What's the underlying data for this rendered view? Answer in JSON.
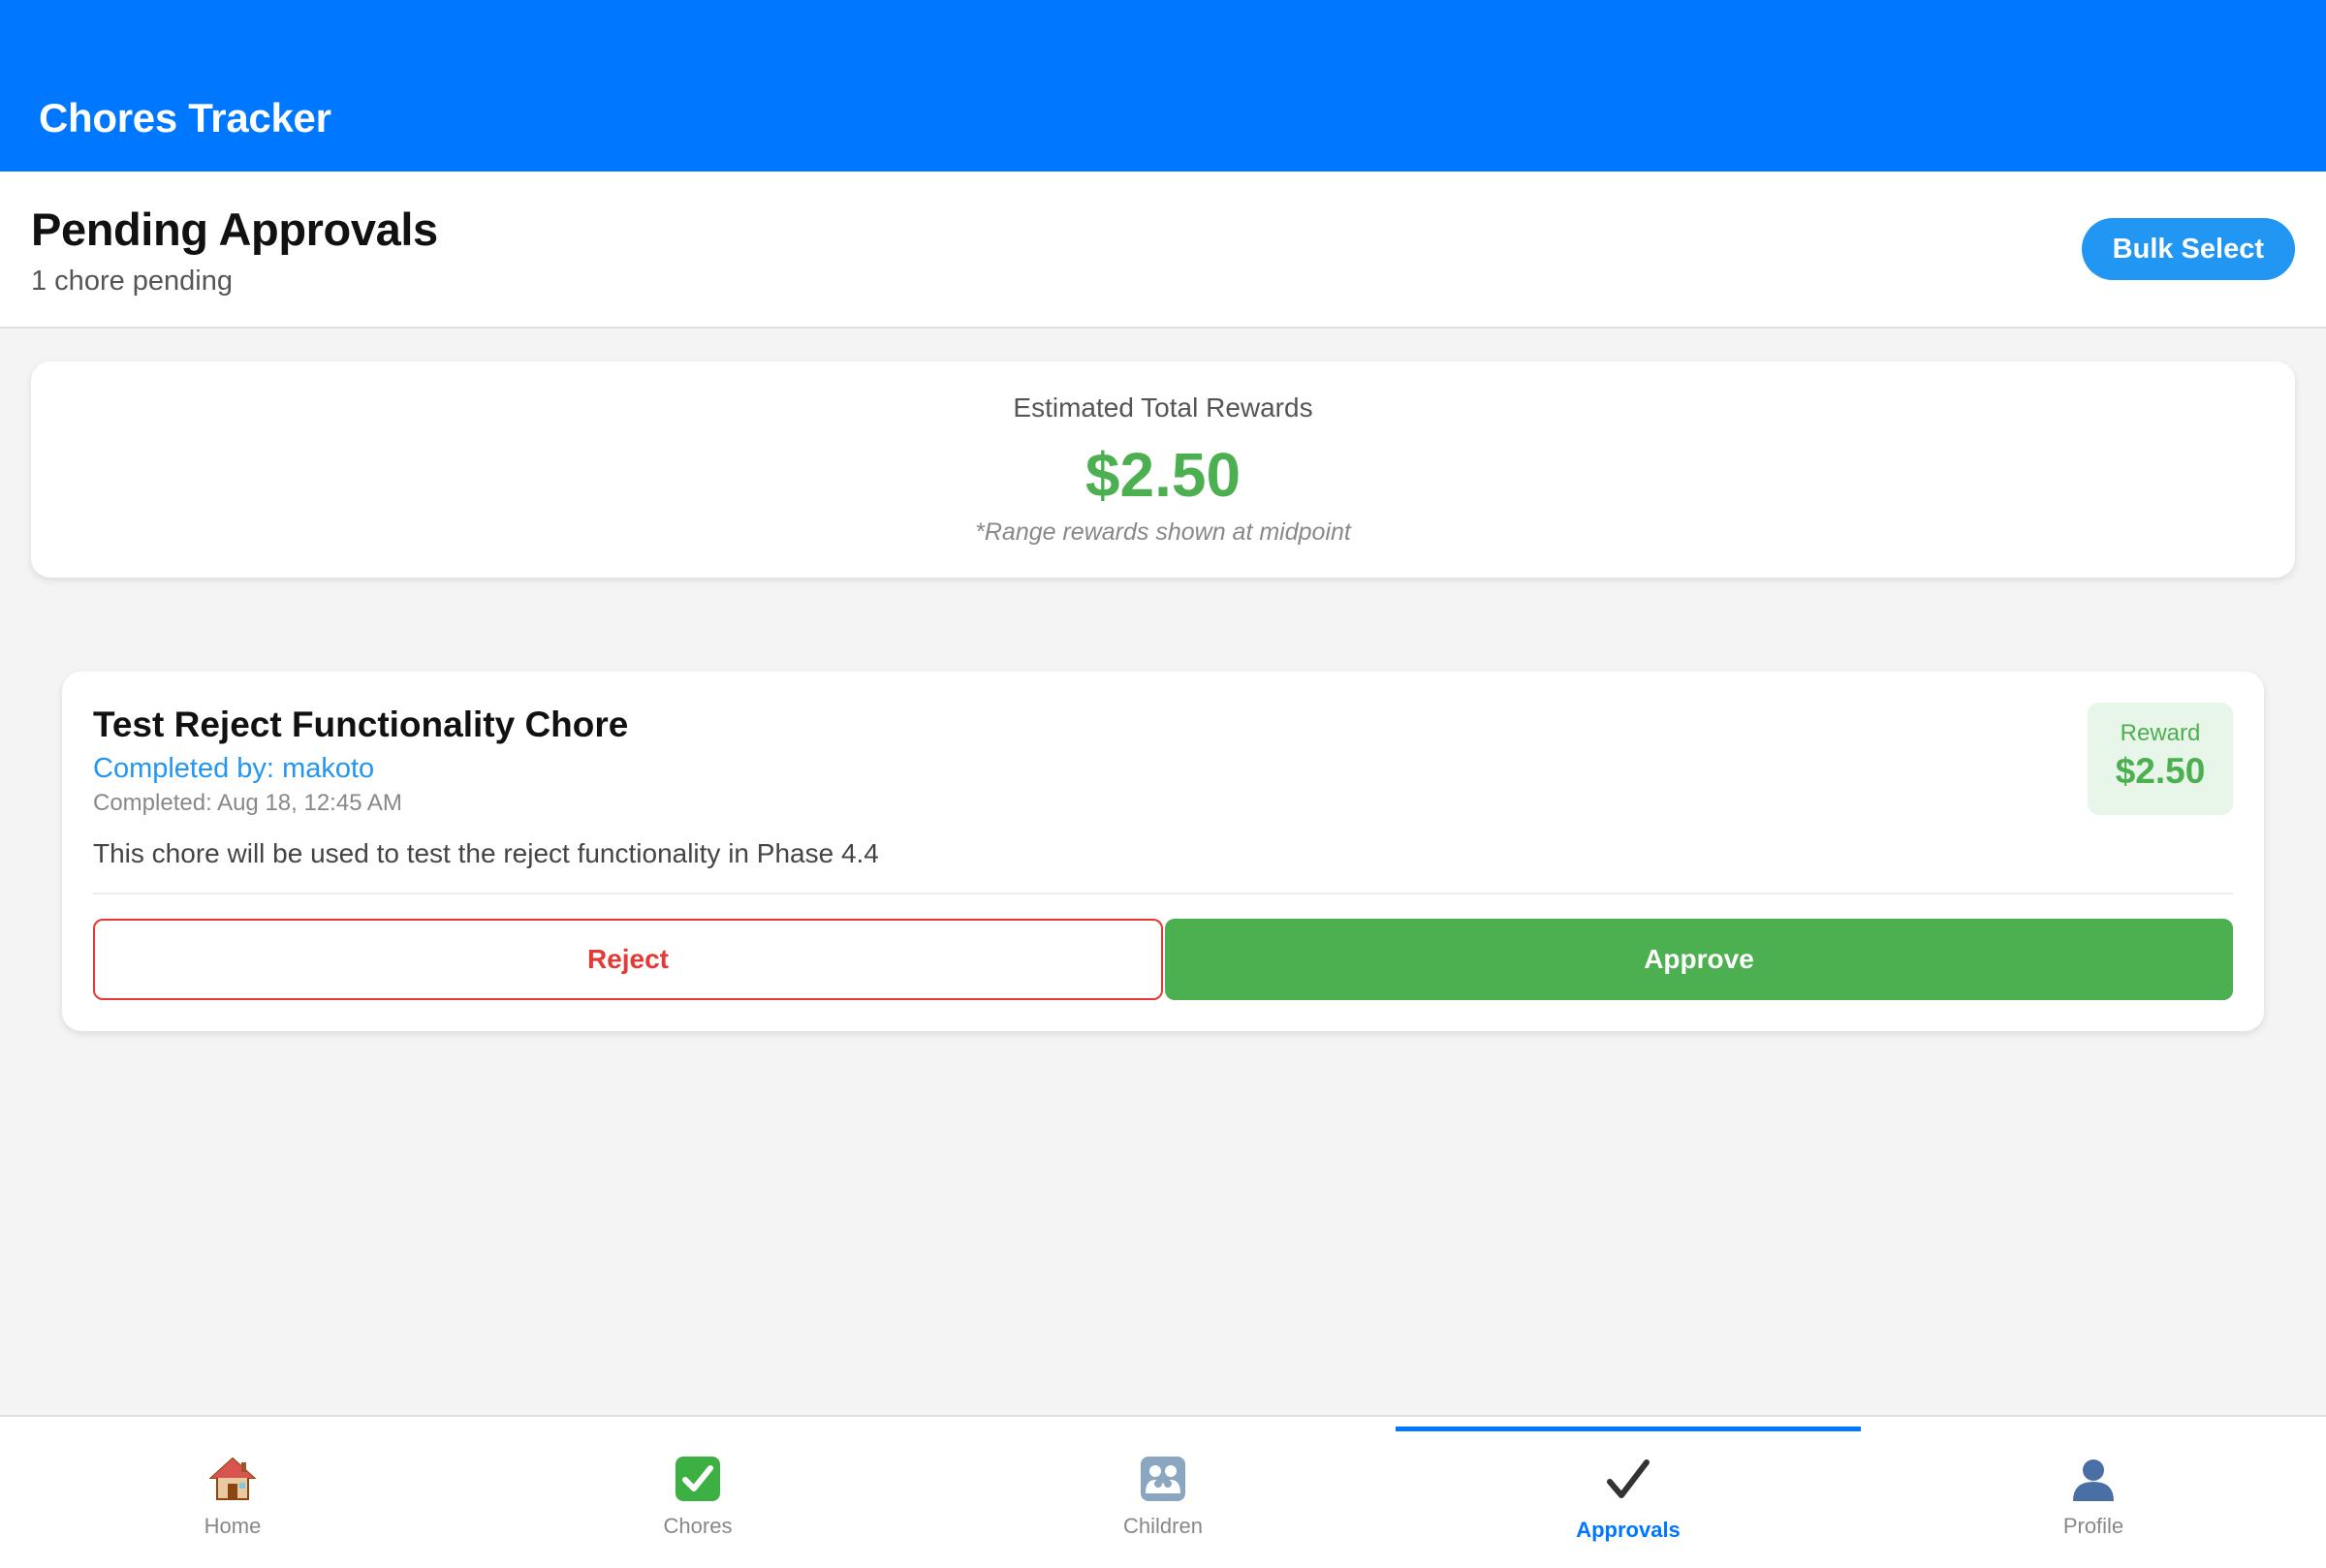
{
  "app": {
    "title": "Chores Tracker",
    "colors": {
      "header": "#0077ff",
      "accent_blue": "#2196f3",
      "success": "#4caf50",
      "danger": "#e53935"
    }
  },
  "page": {
    "title": "Pending Approvals",
    "subtitle": "1 chore pending",
    "bulk_select_label": "Bulk Select"
  },
  "summary": {
    "label": "Estimated Total Rewards",
    "amount": "$2.50",
    "note": "*Range rewards shown at midpoint"
  },
  "chores": [
    {
      "title": "Test Reject Functionality Chore",
      "completed_by_label": "Completed by:",
      "completed_by": "makoto",
      "completed_time": "Completed: Aug 18, 12:45 AM",
      "description": "This chore will be used to test the reject functionality in Phase 4.4",
      "reward_label": "Reward",
      "reward_value": "$2.50",
      "reject_label": "Reject",
      "approve_label": "Approve"
    }
  ],
  "tabs": [
    {
      "label": "Home",
      "icon": "house-icon"
    },
    {
      "label": "Chores",
      "icon": "check-box-icon"
    },
    {
      "label": "Children",
      "icon": "family-icon"
    },
    {
      "label": "Approvals",
      "icon": "checkmark-icon",
      "active": true
    },
    {
      "label": "Profile",
      "icon": "person-silhouette-icon"
    }
  ]
}
